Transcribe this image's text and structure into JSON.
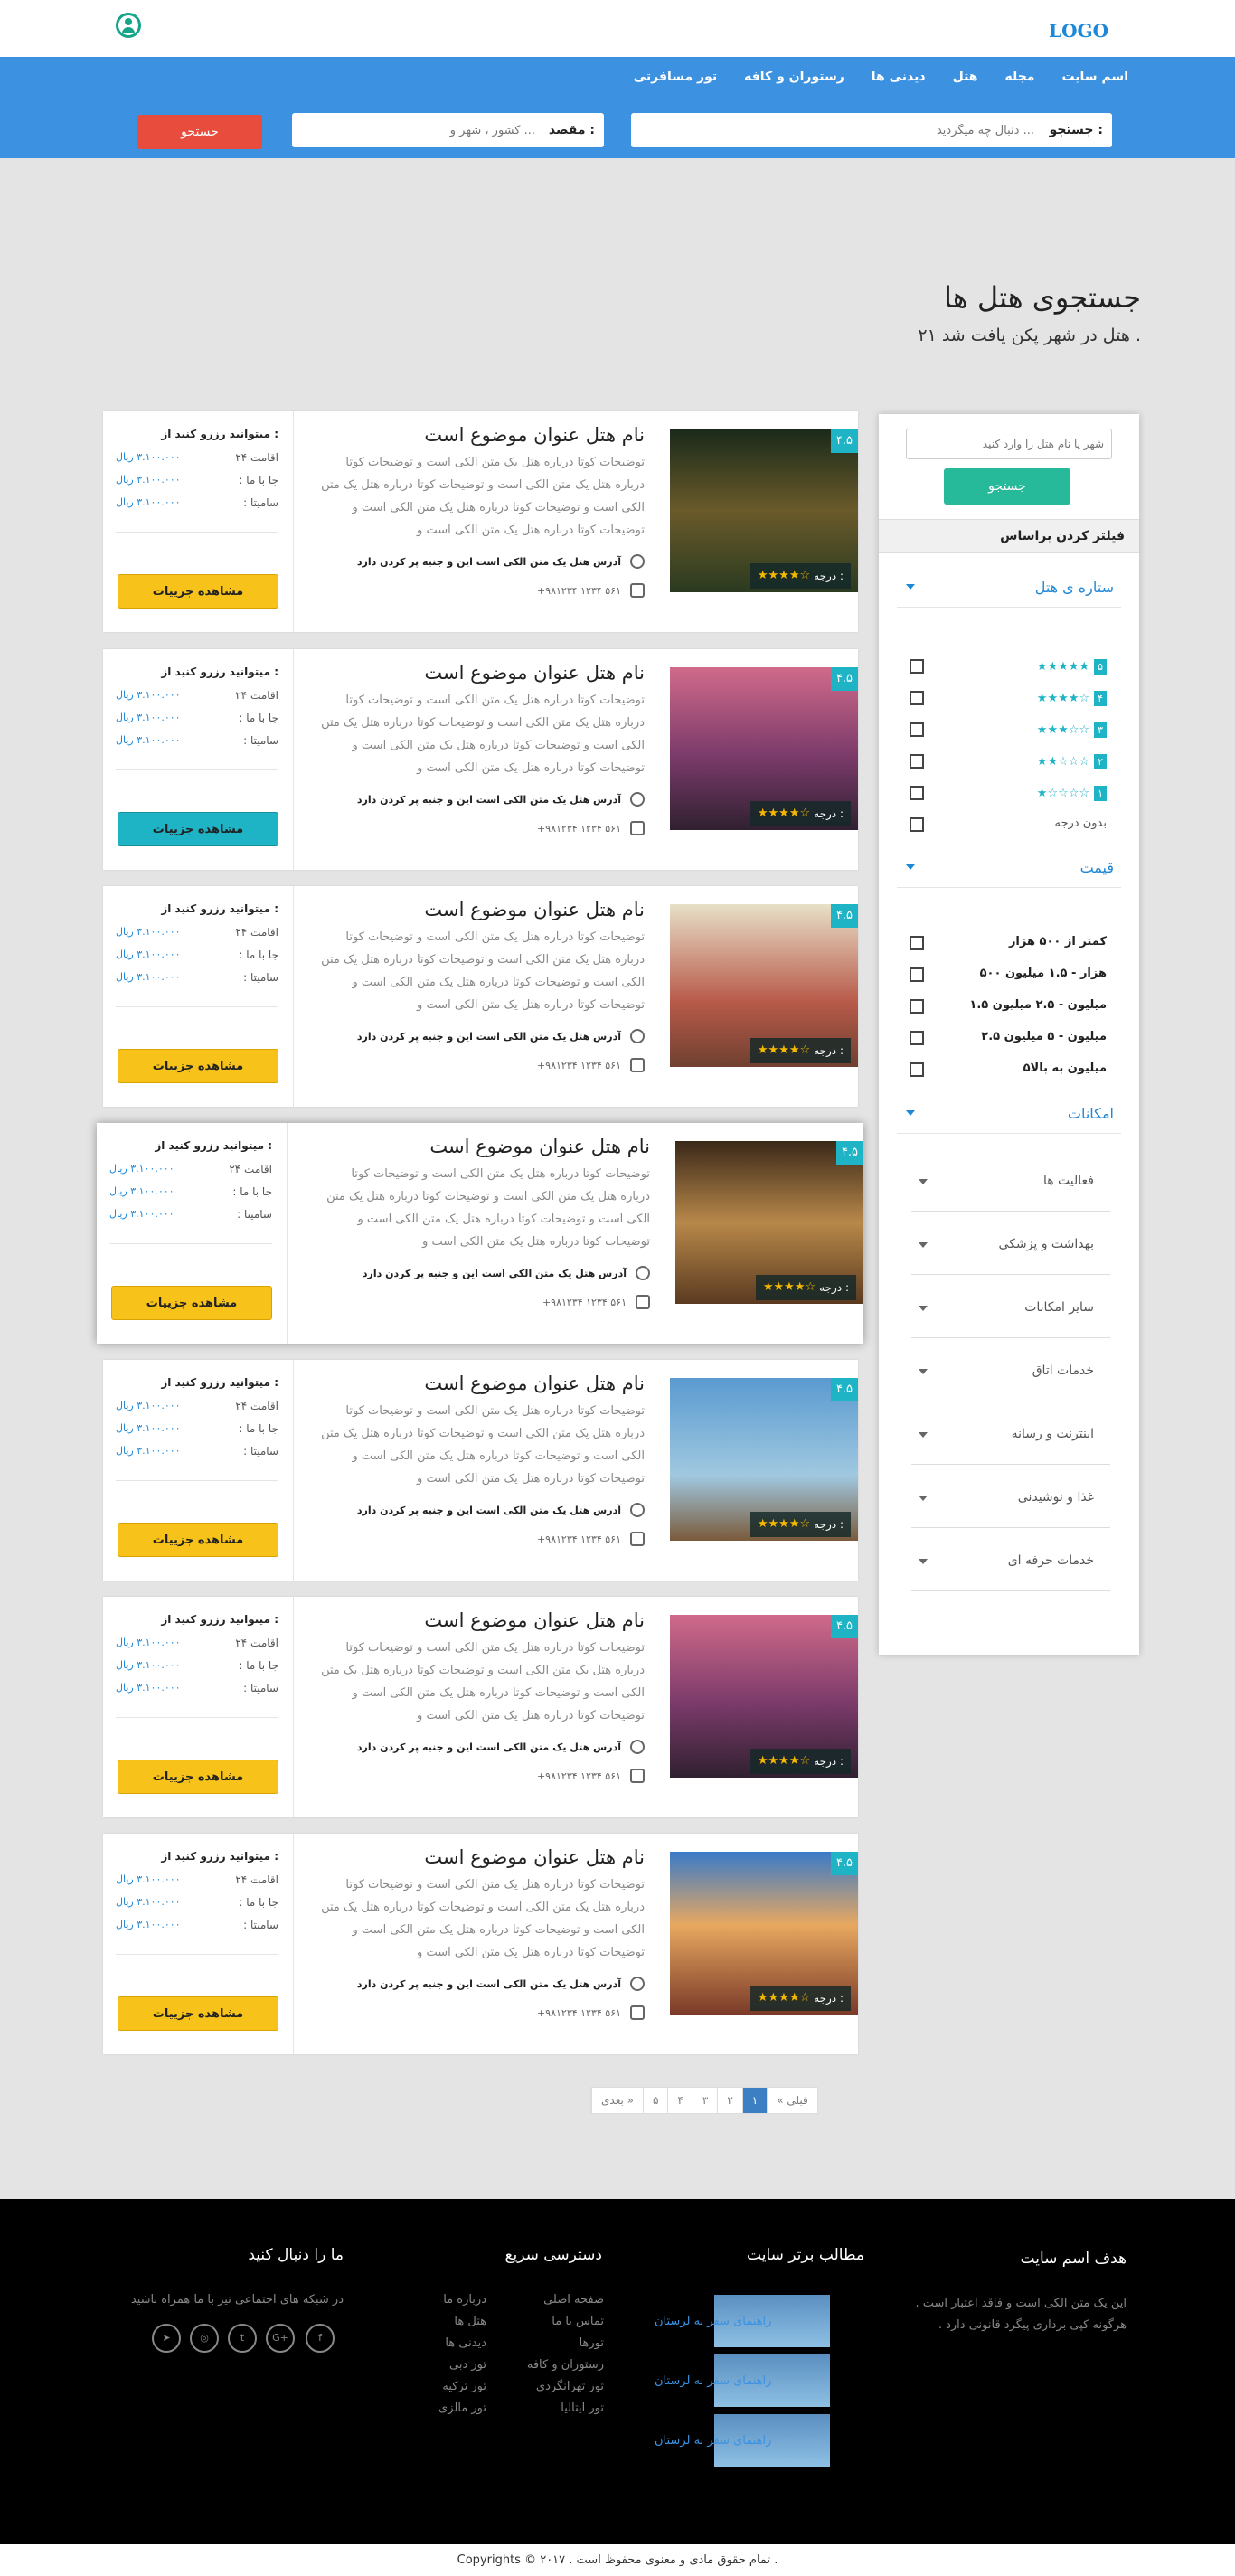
{
  "header": {
    "logo": "LOGO"
  },
  "nav": [
    "اسم سایت",
    "مجله",
    "هتل",
    "دیدنی ها",
    "رستوران و کافه",
    "تور مسافرتی"
  ],
  "search": {
    "label": "جستجو :",
    "placeholder": "دنبال چه میگردید ...",
    "dest_label": "مقصد :",
    "dest_placeholder": "کشور ، شهر و ...",
    "button": "جستجو"
  },
  "page": {
    "title": "جستجوی هتل ها",
    "subtitle": "۲۱ هتل در شهر پکن یافت شد ."
  },
  "sidebar": {
    "name_placeholder": "شهر یا نام هتل را وارد کنید",
    "search_button": "جستجو",
    "filter_title": "فیلتر کردن براساس",
    "stars_title": "ستاره ی هتل",
    "stars": [
      "۵",
      "۴",
      "۳",
      "۲",
      "۱"
    ],
    "no_star": "بدون درجه",
    "price_title": "قیمت",
    "prices": [
      "کمتر از ۵۰۰ هزار",
      "۵۰۰ هزار - ۱.۵ میلیون",
      "۱.۵ میلیون - ۲.۵ میلیون",
      "۲.۵ میلیون - ۵ میلیون",
      "۵میلیون به بالا"
    ],
    "amen_title": "امکانات",
    "amenities": [
      "فعالیت ها",
      "بهداشت و پزشکی",
      "سایر امکانات",
      "خدمات اتاق",
      "اینترنت و رسانه",
      "غذا و نوشیدنی",
      "خدمات حرفه ای"
    ]
  },
  "hotel": {
    "title": "نام هتل عنوان موضوع است",
    "desc": "توضیحات کوتا درباره هتل یک متن الکی است و توضیحات کوتا درباره هتل یک متن الکی است و توضیحات کوتا درباره هتل یک متن الکی است و توضیحات کوتا درباره هتل یک متن الکی است و توضیحات کوتا درباره هتل یک متن الکی است و",
    "rate": "۴.۵",
    "degree": "درجه :",
    "address": "آدرس هتل یک متن الکی است این و جنبه پر کردن دارد",
    "phone": "+۹۸۱۲۳۴ ۱۲۳۴ ۵۶۱",
    "price_head": "میتوانید رزرو کنید از :",
    "p1": "اقامت ۲۴",
    "p2": "جا با ما :",
    "p3": "سامیتا :",
    "val": "۳.۱۰۰.۰۰۰ ریال",
    "details": "مشاهده جزییات"
  },
  "pager": [
    "« قبلی",
    "۱",
    "۲",
    "۳",
    "۴",
    "۵",
    "بعدی »"
  ],
  "footer": {
    "about_t": "هدف اسم سایت",
    "about": "این یک متن الکی است و فاقد اعتبار است . هرگونه کپی برداری پیگرد قانونی دارد .",
    "top_t": "مطالب برتر سایت",
    "top_link": "راهنمای سفر به لرستان",
    "quick_t": "دسترسی سریع",
    "q1": [
      "صفحه اصلی",
      "تماس با ما",
      "تورها",
      "رستوران و کافه",
      "تور تهرانگردی",
      "تور ایتالیا"
    ],
    "q2": [
      "درباره ما",
      "هتل ها",
      "دیدنی ها",
      "تور دبی",
      "تور ترکیه",
      "تور مالزی"
    ],
    "follow_t": "ما را دنبال کنید",
    "follow": "در شبکه های اجتماعی نیز با ما همراه باشید",
    "copy": "Copyrights © ۲۰۱۷ . تمام حقوق مادی و معنوی محفوظ است ."
  },
  "colors": {
    "brand": "#3c92e0",
    "accent": "#1eb3c5",
    "button": "#f7c21a",
    "search_btn": "#e84c3d"
  }
}
